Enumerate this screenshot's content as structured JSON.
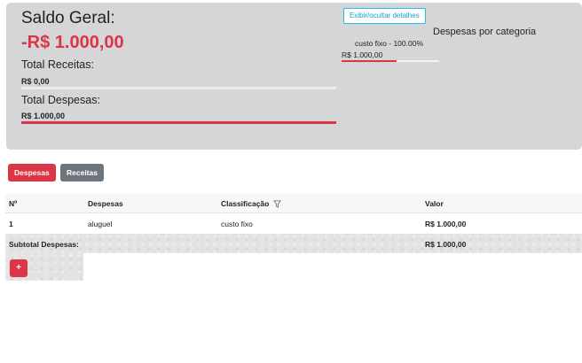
{
  "summary": {
    "title": "Saldo Geral:",
    "balance": "-R$ 1.000,00",
    "total_income_label": "Total Receitas:",
    "total_income_value": "R$ 0,00",
    "income_fill_percent": 0,
    "total_expenses_label": "Total Despesas:",
    "total_expenses_value": "R$ 1.000,00",
    "expenses_fill_percent": 100,
    "accent_color": "#dc3545"
  },
  "categories": {
    "toggle_label": "Exibir/ocultar detalhes",
    "title": "Despesas por categoria",
    "items": [
      {
        "label": "custo fixo - 100.00%",
        "value": "R$ 1.000,00",
        "percent": 100
      }
    ]
  },
  "tabs": {
    "expenses_label": "Despesas",
    "income_label": "Receitas"
  },
  "table": {
    "headers": {
      "number": "Nº",
      "expense": "Despesas",
      "classification": "Classificação",
      "value": "Valor"
    },
    "filter_icon": "funnel-icon",
    "rows": [
      {
        "number": "1",
        "expense": "aluguel",
        "classification": "custo fixo",
        "value": "R$ 1.000,00"
      }
    ],
    "subtotal_label": "Subtotal Despesas:",
    "subtotal_value": "R$ 1.000,00",
    "add_label": "+"
  }
}
